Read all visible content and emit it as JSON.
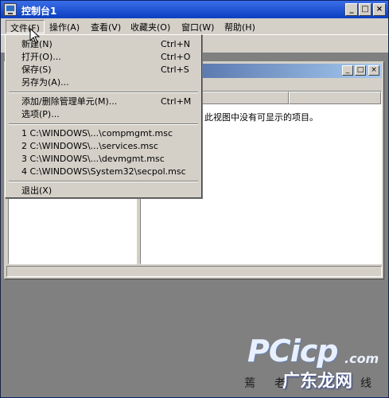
{
  "window": {
    "title": "控制台1",
    "minimize": "_",
    "maximize": "□",
    "close": "×"
  },
  "menubar": [
    {
      "label": "文件(F)",
      "active": true
    },
    {
      "label": "操作(A)"
    },
    {
      "label": "查看(V)"
    },
    {
      "label": "收藏夹(O)"
    },
    {
      "label": "窗口(W)"
    },
    {
      "label": "帮助(H)"
    }
  ],
  "child_window": {
    "empty_message": "此视图中没有可显示的项目。"
  },
  "file_menu": {
    "items": [
      {
        "label": "新建(N)",
        "shortcut": "Ctrl+N"
      },
      {
        "label": "打开(O)...",
        "shortcut": "Ctrl+O"
      },
      {
        "label": "保存(S)",
        "shortcut": "Ctrl+S"
      },
      {
        "label": "另存为(A)..."
      },
      {
        "label": "添加/删除管理单元(M)...",
        "shortcut": "Ctrl+M"
      },
      {
        "label": "选项(P)..."
      },
      {
        "label": "1 C:\\WINDOWS\\...\\compmgmt.msc"
      },
      {
        "label": "2 C:\\WINDOWS\\...\\services.msc"
      },
      {
        "label": "3 C:\\WINDOWS\\...\\devmgmt.msc"
      },
      {
        "label": "4 C:\\WINDOWS\\System32\\secpol.msc"
      },
      {
        "label": "退出(X)"
      }
    ]
  },
  "watermark": {
    "logo": "PCicp",
    "logo_suffix": ".com",
    "chars": [
      "蔫",
      "老",
      "线"
    ],
    "big_text": "广东龙网"
  }
}
